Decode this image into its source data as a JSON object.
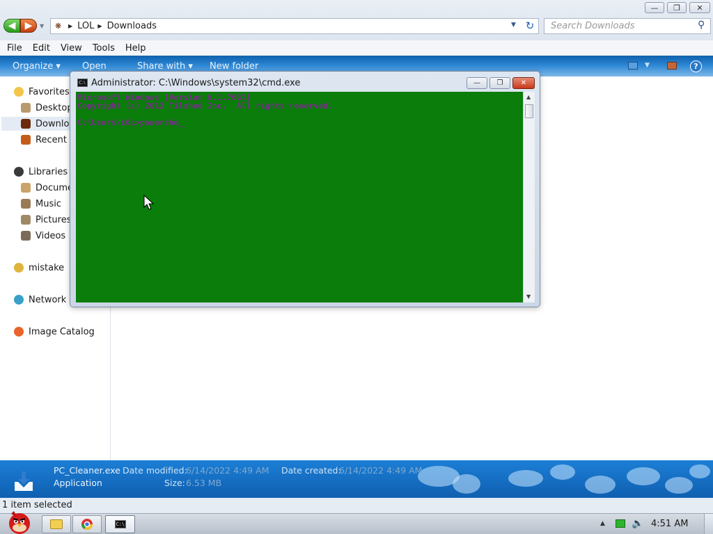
{
  "explorer": {
    "address": {
      "crumbs": [
        "LOL",
        "Downloads"
      ]
    },
    "search": {
      "placeholder": "Search Downloads"
    },
    "menu": [
      "File",
      "Edit",
      "View",
      "Tools",
      "Help"
    ],
    "commands": {
      "organize": "Organize",
      "open": "Open",
      "share_with": "Share with",
      "new_folder": "New folder"
    },
    "nav": {
      "favorites": "Favorites",
      "desktop": "Desktop",
      "downloads": "Downloads",
      "recent": "Recent Places",
      "libraries": "Libraries",
      "documents": "Documents",
      "music": "Music",
      "pictures": "Pictures",
      "videos": "Videos",
      "homegroup": "mistake",
      "network": "Network",
      "image_catalog": "Image Catalog"
    },
    "details": {
      "file_name": "PC_Cleaner.exe",
      "file_type": "Application",
      "date_modified_label": "Date modified:",
      "date_modified": "6/14/2022 4:49 AM",
      "date_created_label": "Date created:",
      "date_created": "6/14/2022 4:49 AM",
      "size_label": "Size:",
      "size": "6.53 MB"
    },
    "status": "1 item selected"
  },
  "cmd": {
    "title": "Administrator: C:\\Windows\\system32\\cmd.exe",
    "lines": [
      "Microsoft Windows [Version 6.1.7601]",
      "Copyright (c) 2012 Tilshed Inc.  All rights reserved.",
      "",
      "C:\\Users\\LOL>powershe_"
    ],
    "console_color": "#0a7d0a",
    "text_color": "#7b2a8c"
  },
  "taskbar": {
    "clock": "4:51 AM"
  }
}
